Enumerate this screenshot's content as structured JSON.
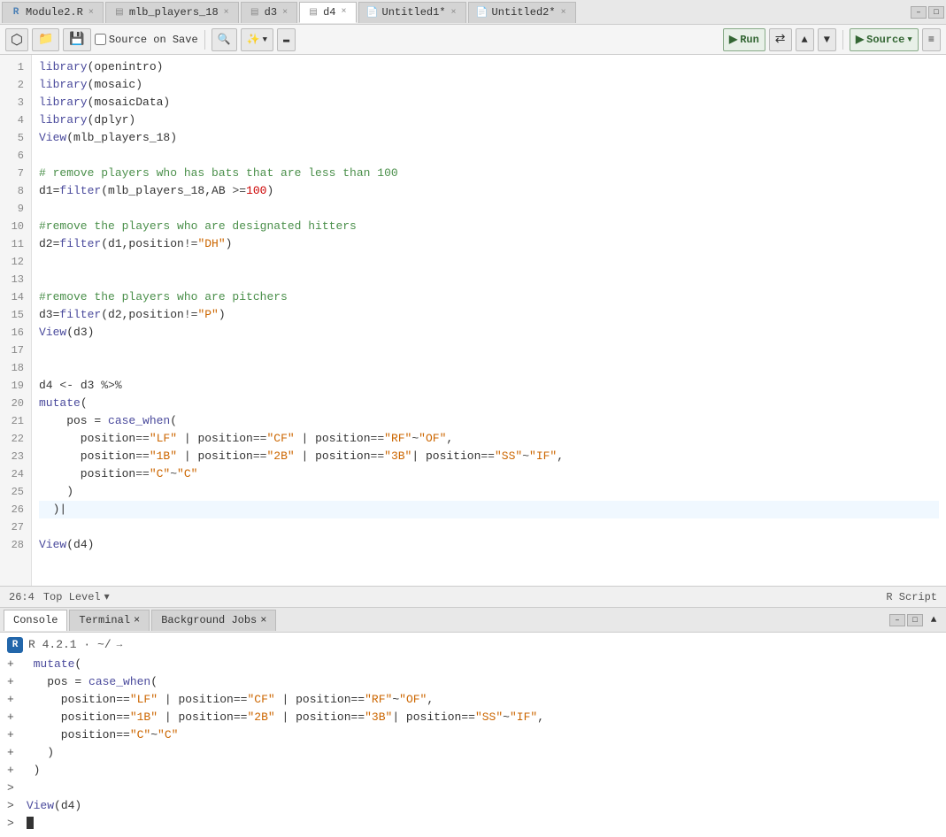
{
  "tabs": [
    {
      "id": "module2",
      "label": "Module2.R",
      "type": "r",
      "active": false,
      "modified": false
    },
    {
      "id": "mlb",
      "label": "mlb_players_18",
      "type": "csv",
      "active": false,
      "modified": false
    },
    {
      "id": "d3",
      "label": "d3",
      "type": "r",
      "active": false,
      "modified": false
    },
    {
      "id": "d4",
      "label": "d4",
      "type": "r",
      "active": true,
      "modified": false
    },
    {
      "id": "untitled1",
      "label": "Untitled1",
      "type": "r-script",
      "active": false,
      "modified": true
    },
    {
      "id": "untitled2",
      "label": "Untitled2",
      "type": "r-script",
      "active": false,
      "modified": true
    }
  ],
  "toolbar": {
    "source_on_save_label": "Source on Save",
    "run_label": "Run",
    "source_label": "Source",
    "re_run_label": "Re-run"
  },
  "editor": {
    "lines": [
      {
        "num": 1,
        "code": "library(openintro)",
        "type": "fn_call"
      },
      {
        "num": 2,
        "code": "library(mosaic)",
        "type": "fn_call"
      },
      {
        "num": 3,
        "code": "library(mosaicData)",
        "type": "fn_call"
      },
      {
        "num": 4,
        "code": "library(dplyr)",
        "type": "fn_call"
      },
      {
        "num": 5,
        "code": "View(mlb_players_18)",
        "type": "fn_call"
      },
      {
        "num": 6,
        "code": "",
        "type": "empty"
      },
      {
        "num": 7,
        "code": "# remove players who has bats that are less than 100",
        "type": "comment"
      },
      {
        "num": 8,
        "code": "d1=filter(mlb_players_18,AB >= 100)",
        "type": "code"
      },
      {
        "num": 9,
        "code": "",
        "type": "empty"
      },
      {
        "num": 10,
        "code": "#remove the players who are designated hitters",
        "type": "comment"
      },
      {
        "num": 11,
        "code": "d2=filter(d1,position!=\"DH\")",
        "type": "code"
      },
      {
        "num": 12,
        "code": "",
        "type": "empty"
      },
      {
        "num": 13,
        "code": "",
        "type": "empty"
      },
      {
        "num": 14,
        "code": "#remove the players who are pitchers",
        "type": "comment"
      },
      {
        "num": 15,
        "code": "d3=filter(d2,position!=\"P\")",
        "type": "code"
      },
      {
        "num": 16,
        "code": "View(d3)",
        "type": "fn_call"
      },
      {
        "num": 17,
        "code": "",
        "type": "empty"
      },
      {
        "num": 18,
        "code": "",
        "type": "empty"
      },
      {
        "num": 19,
        "code": "d4 <- d3 %>%",
        "type": "code"
      },
      {
        "num": 20,
        "code": "  mutate(",
        "type": "code"
      },
      {
        "num": 21,
        "code": "    pos = case_when(",
        "type": "code"
      },
      {
        "num": 22,
        "code": "      position==\"LF\" | position==\"CF\" | position==\"RF\"~\"OF\",",
        "type": "code"
      },
      {
        "num": 23,
        "code": "      position==\"1B\" | position==\"2B\" | position==\"3B\"| position==\"SS\"~\"IF\",",
        "type": "code"
      },
      {
        "num": 24,
        "code": "      position==\"C\"~\"C\"",
        "type": "code"
      },
      {
        "num": 25,
        "code": "    )",
        "type": "code"
      },
      {
        "num": 26,
        "code": "  )|",
        "type": "code"
      },
      {
        "num": 27,
        "code": "",
        "type": "empty"
      },
      {
        "num": 28,
        "code": "View(d4)",
        "type": "fn_call"
      }
    ]
  },
  "statusbar": {
    "position": "26:4",
    "level": "Top Level",
    "script_type": "R Script"
  },
  "console": {
    "tabs": [
      {
        "label": "Console",
        "active": true
      },
      {
        "label": "Terminal",
        "active": false
      },
      {
        "label": "Background Jobs",
        "active": false
      }
    ],
    "r_version": "R 4.2.1 · ~/",
    "lines": [
      {
        "prompt": "+",
        "text": "  mutate("
      },
      {
        "prompt": "+",
        "text": "    pos = case_when("
      },
      {
        "prompt": "+",
        "text": "      position==\"LF\" | position==\"CF\" | position==\"RF\"~\"OF\","
      },
      {
        "prompt": "+",
        "text": "      position==\"1B\" | position==\"2B\" | position==\"3B\"| position==\"SS\"~\"IF\","
      },
      {
        "prompt": "+",
        "text": "      position==\"C\"~\"C\""
      },
      {
        "prompt": "+",
        "text": "    )"
      },
      {
        "prompt": "+",
        "text": "  )"
      },
      {
        "prompt": ">",
        "text": ""
      },
      {
        "prompt": ">",
        "text": " View(d4)"
      },
      {
        "prompt": ">",
        "text": ""
      }
    ]
  }
}
